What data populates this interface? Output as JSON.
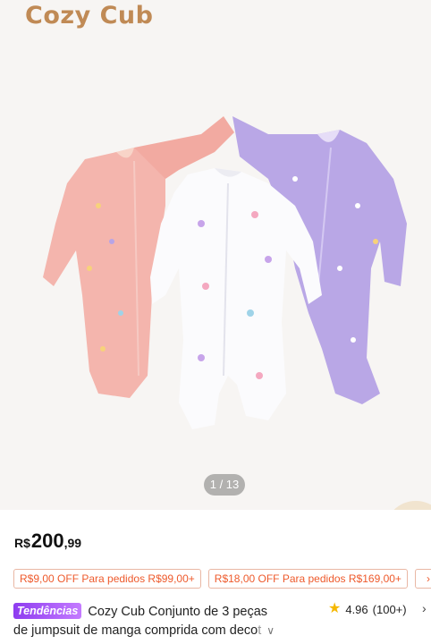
{
  "brand": {
    "logo_text": "Cozy Cub"
  },
  "gallery": {
    "counter": "1 / 13"
  },
  "price": {
    "currency": "R$",
    "integer": "200",
    "decimal": ",99"
  },
  "coupons": [
    "R$9,00 OFF Para pedidos R$99,00+",
    "R$18,00 OFF Para pedidos R$169,00+"
  ],
  "coupons_more_icon": "chevron-right",
  "product": {
    "badge": "Tendências",
    "title_line1": "Cozy Cub Conjunto de 3 peças",
    "title_line2": "de jumpsuit de manga comprida com deco",
    "title_fade": "t"
  },
  "rating": {
    "score": "4.96",
    "count": "(100+)"
  },
  "colors": {
    "accent": "#ee5a2c",
    "badge_start": "#8e3cf0",
    "badge_end": "#c47bff",
    "star": "#f5b800",
    "brand": "#c08a55"
  }
}
